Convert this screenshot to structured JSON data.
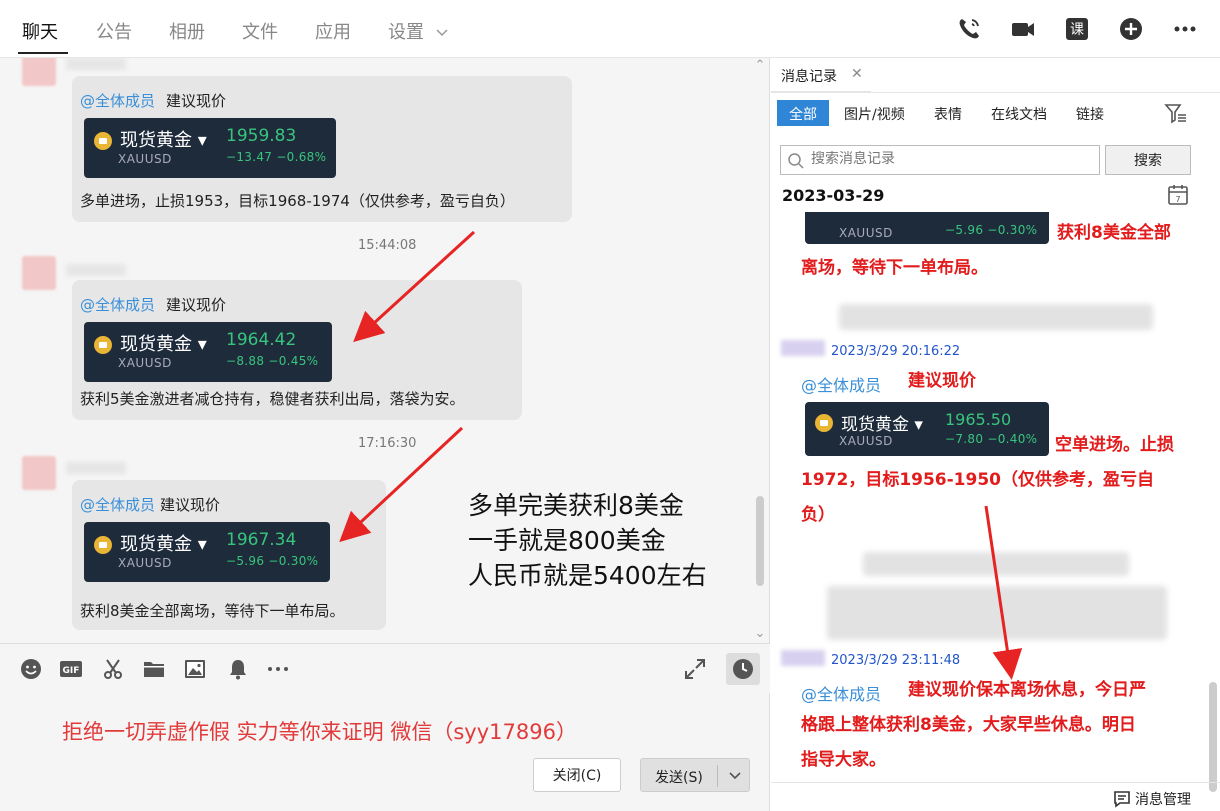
{
  "topbar": {
    "tabs": [
      "聊天",
      "公告",
      "相册",
      "文件",
      "应用",
      "设置"
    ],
    "icons": [
      "phone-icon",
      "video-icon",
      "course-icon",
      "plus-icon",
      "more-icon"
    ],
    "course_label": "课"
  },
  "messages": [
    {
      "mention": "@全体成员",
      "advice": "建议现价",
      "gold": {
        "name": "现货黄金",
        "symbol": "XAUUSD",
        "price": "1959.83",
        "change": "−13.47 −0.68%"
      },
      "text": "多单进场，止损1953，目标1968-1974（仅供参考，盈亏自负）"
    },
    {
      "time": "15:44:08",
      "mention": "@全体成员",
      "advice": "建议现价",
      "gold": {
        "name": "现货黄金",
        "symbol": "XAUUSD",
        "price": "1964.42",
        "change": "−8.88 −0.45%"
      },
      "text": "获利5美金激进者减仓持有，稳健者获利出局，落袋为安。"
    },
    {
      "time": "17:16:30",
      "mention": "@全体成员",
      "advice": "建议现价",
      "gold": {
        "name": "现货黄金",
        "symbol": "XAUUSD",
        "price": "1967.34",
        "change": "−5.96 −0.30%"
      },
      "text": "获利8美金全部离场，等待下一单布局。"
    }
  ],
  "overlay": [
    "多单完美获利8美金",
    "一手就是800美金",
    "人民币就是5400左右"
  ],
  "compose": {
    "text": "拒绝一切弄虚作假 实力等你来证明 微信（syy17896）",
    "close_label": "关闭(C)",
    "send_label": "发送(S)"
  },
  "history": {
    "tab_label": "消息记录",
    "filters": [
      "全部",
      "图片/视频",
      "表情",
      "在线文档",
      "链接"
    ],
    "search_placeholder": "搜索消息记录",
    "search_button": "搜索",
    "date": "2023-03-29",
    "calendar_day": "7",
    "partial_card": {
      "symbol": "XAUUSD",
      "change": "−5.96 −0.30%"
    },
    "red_text_1a": "获利8美金全部",
    "red_text_1b": "离场，等待下一单布局。",
    "entry2": {
      "time": "2023/3/29 20:16:22",
      "mention": "@全体成员",
      "advice": "建议现价",
      "gold": {
        "name": "现货黄金",
        "symbol": "XAUUSD",
        "price": "1965.50",
        "change": "−7.80 −0.40%"
      },
      "text_a": "空单进场。止损",
      "text_b": "1972，目标1956-1950（仅供参考，盈亏自",
      "text_c": "负）"
    },
    "entry3": {
      "time": "2023/3/29 23:11:48",
      "mention": "@全体成员",
      "text_a": "建议现价保本离场休息，今日严",
      "text_b": "格跟上整体获利8美金，大家早些休息。明日",
      "text_c": "指导大家。"
    },
    "manage_label": "消息管理"
  },
  "colors": {
    "accent": "#2f86d6",
    "red": "#e21c1c",
    "gain": "#39c47e",
    "card": "#1e2b3b"
  }
}
